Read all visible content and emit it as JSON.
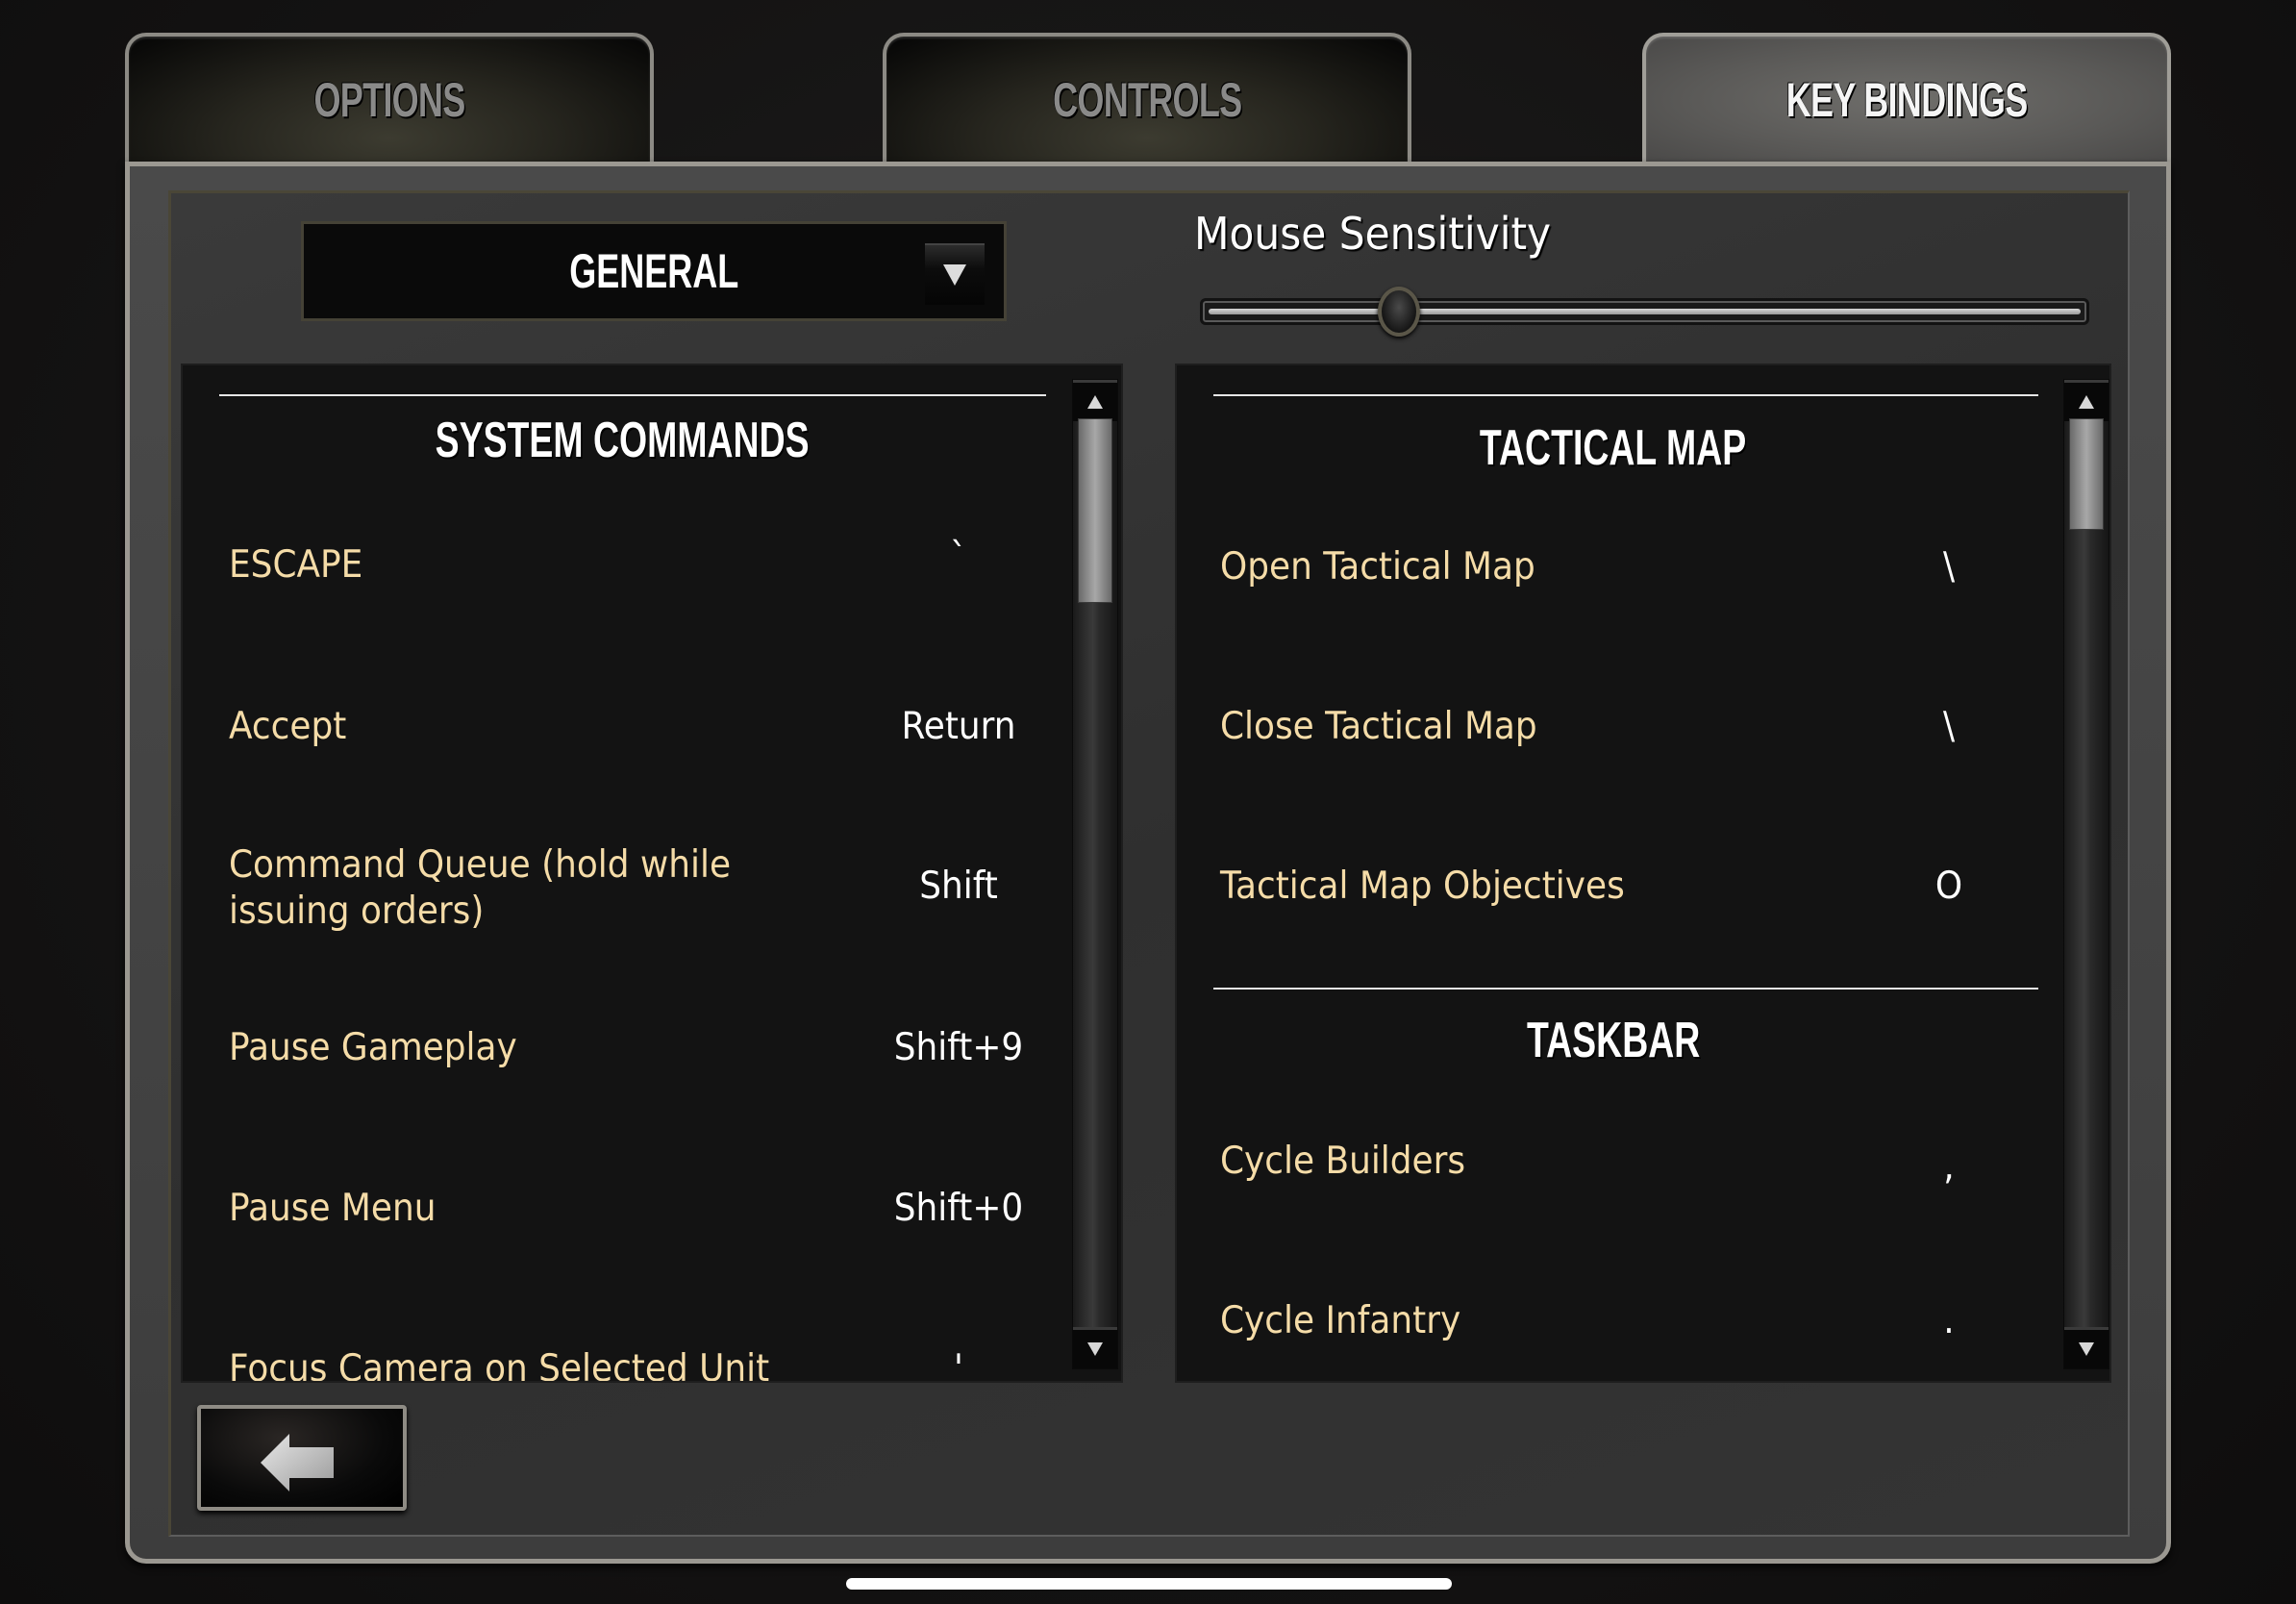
{
  "tabs": [
    {
      "label": "OPTIONS",
      "active": false
    },
    {
      "label": "CONTROLS",
      "active": false
    },
    {
      "label": "KEY BINDINGS",
      "active": true
    }
  ],
  "category_dropdown": {
    "selected": "GENERAL",
    "icon": "chevron-down-icon"
  },
  "mouse_sensitivity": {
    "label": "Mouse Sensitivity",
    "value_fraction": 0.22
  },
  "left_panel": {
    "scroll_position_fraction": 0.0,
    "scroll_thumb_fraction": 0.2,
    "sections": [
      {
        "title": "SYSTEM COMMANDS",
        "bindings": [
          {
            "action": "ESCAPE",
            "key": "`"
          },
          {
            "action": "Accept",
            "key": "Return"
          },
          {
            "action": "Command Queue (hold while issuing orders)",
            "action_lines": [
              "Command Queue (hold while",
              "issuing orders)"
            ],
            "key": "Shift"
          },
          {
            "action": "Pause Gameplay",
            "key": "Shift+9"
          },
          {
            "action": "Pause Menu",
            "key": "Shift+0"
          },
          {
            "action": "Focus Camera on Selected Unit",
            "key": "'"
          }
        ]
      }
    ]
  },
  "right_panel": {
    "scroll_position_fraction": 0.0,
    "scroll_thumb_fraction": 0.12,
    "sections": [
      {
        "title": "TACTICAL MAP",
        "bindings": [
          {
            "action": "Open Tactical Map",
            "key": "\\"
          },
          {
            "action": "Close Tactical Map",
            "key": "\\"
          },
          {
            "action": "Tactical Map Objectives",
            "key": "O"
          }
        ]
      },
      {
        "title": "TASKBAR",
        "bindings": [
          {
            "action": "Cycle Builders",
            "key": ","
          },
          {
            "action": "Cycle Infantry",
            "key": "."
          }
        ]
      }
    ]
  },
  "back_button": {
    "icon": "back-arrow-icon"
  },
  "colors": {
    "action_text": "#f5dca8",
    "key_text": "#ffffff",
    "tab_inactive_text": "#8a8a89",
    "tab_active_text": "#f5f5f5"
  }
}
